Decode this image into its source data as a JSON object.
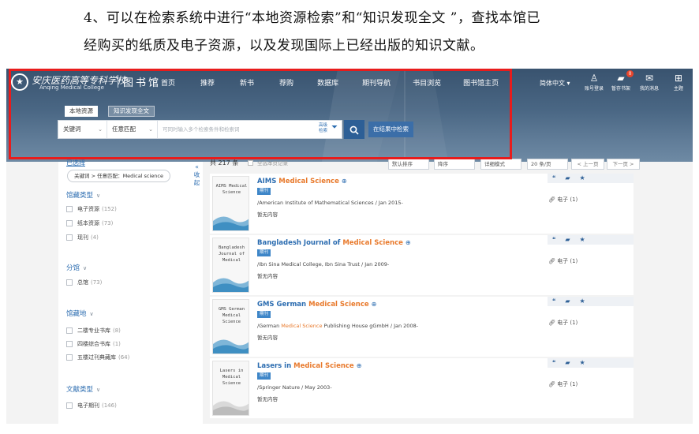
{
  "instruction": {
    "line1": "4、可以在检索系统中进行“本地资源检索”和“知识发现全文 ”，查找本馆已",
    "line2": "经购买的纸质及电子资源，以及发现国际上已经出版的知识文献。"
  },
  "header": {
    "logo_glyph": "★",
    "brand_cn": "安庆医药高等专科学校",
    "brand_en": "Anqing Medical College",
    "library_label": "图书馆",
    "nav": [
      "首页",
      "推荐",
      "新书",
      "荐购",
      "数据库",
      "期刊导航",
      "书目浏览",
      "图书馆主页"
    ],
    "language": "简体中文 ▾",
    "utilities": [
      {
        "icon": "user-icon",
        "glyph": "♙",
        "label": "账号登录"
      },
      {
        "icon": "folder-icon",
        "glyph": "▰",
        "label": "暂存书架",
        "badge": "0"
      },
      {
        "icon": "mail-icon",
        "glyph": "✉",
        "label": "我的消息"
      },
      {
        "icon": "grid-icon",
        "glyph": "⊞",
        "label": "主题"
      }
    ]
  },
  "search": {
    "tabs": [
      "本地资源",
      "知识发现全文"
    ],
    "field_select": "关键词",
    "match_select": "任意匹配",
    "placeholder": "可同时输入多个检索条件和检索词",
    "advanced": "高级检索",
    "search_icon": "search-icon",
    "in_results_button": "在结果中检索"
  },
  "sidebar": {
    "collapse_label": "收起",
    "filtered_title": "已选择",
    "chip": "关键词 > 任意匹配：Medical science",
    "facets": [
      {
        "title": "馆藏类型",
        "items": [
          {
            "label": "电子资源",
            "count": "(152)"
          },
          {
            "label": "纸本资源",
            "count": "(73)"
          },
          {
            "label": "现刊",
            "count": "(4)"
          }
        ]
      },
      {
        "title": "分馆",
        "items": [
          {
            "label": "总馆",
            "count": "(73)"
          }
        ]
      },
      {
        "title": "馆藏地",
        "items": [
          {
            "label": "二楼专业书库",
            "count": "(8)"
          },
          {
            "label": "四楼综合书库",
            "count": "(1)"
          },
          {
            "label": "五楼过刊典藏库",
            "count": "(64)"
          }
        ]
      },
      {
        "title": "文献类型",
        "items": [
          {
            "label": "电子期刊",
            "count": "(146)"
          }
        ]
      }
    ]
  },
  "results": {
    "total": "共 217 条",
    "hint": "全选本页记录",
    "sort_options": [
      "默认排序",
      "降序",
      "详细模式",
      "20 条/页"
    ],
    "prev": "< 上一页",
    "next": "下一页 >",
    "items": [
      {
        "title_pre": "AIMS ",
        "title_hl": "Medical Science",
        "title_post": "",
        "cover": "AIMS Medical Science",
        "tag": "期刊",
        "pub_pre": "/American Institute of Mathematical Sciences / Jan 2015-",
        "pub_hl": "",
        "pub_post": "",
        "nocontent": "暂无内容",
        "eres": "电子 (1)"
      },
      {
        "title_pre": "Bangladesh Journal of ",
        "title_hl": "Medical Science",
        "title_post": "",
        "cover": "Bangladesh Journal of Medical",
        "tag": "期刊",
        "pub_pre": "/Ibn Sina Medical College, Ibn Sina Trust / Jan 2009-",
        "pub_hl": "",
        "pub_post": "",
        "nocontent": "暂无内容",
        "eres": "电子 (1)"
      },
      {
        "title_pre": "GMS German ",
        "title_hl": "Medical Science",
        "title_post": "",
        "cover": "GMS German Medical Science",
        "tag": "期刊",
        "pub_pre": "/German ",
        "pub_hl": "Medical Science",
        "pub_post": " Publishing House gGmbH / Jan 2008-",
        "nocontent": "暂无内容",
        "eres": "电子 (1)"
      },
      {
        "title_pre": "Lasers in ",
        "title_hl": "Medical Science",
        "title_post": "",
        "cover": "Lasers in Medical Science",
        "tag": "期刊",
        "pub_pre": "/Springer Nature / May 2003-",
        "pub_hl": "",
        "pub_post": "",
        "nocontent": "暂无内容",
        "eres": "电子 (1)"
      }
    ]
  },
  "colors": {
    "accent": "#2b6cb0",
    "highlight": "#e8792b",
    "annotation": "#e81c1c",
    "header": "#4a6784"
  }
}
